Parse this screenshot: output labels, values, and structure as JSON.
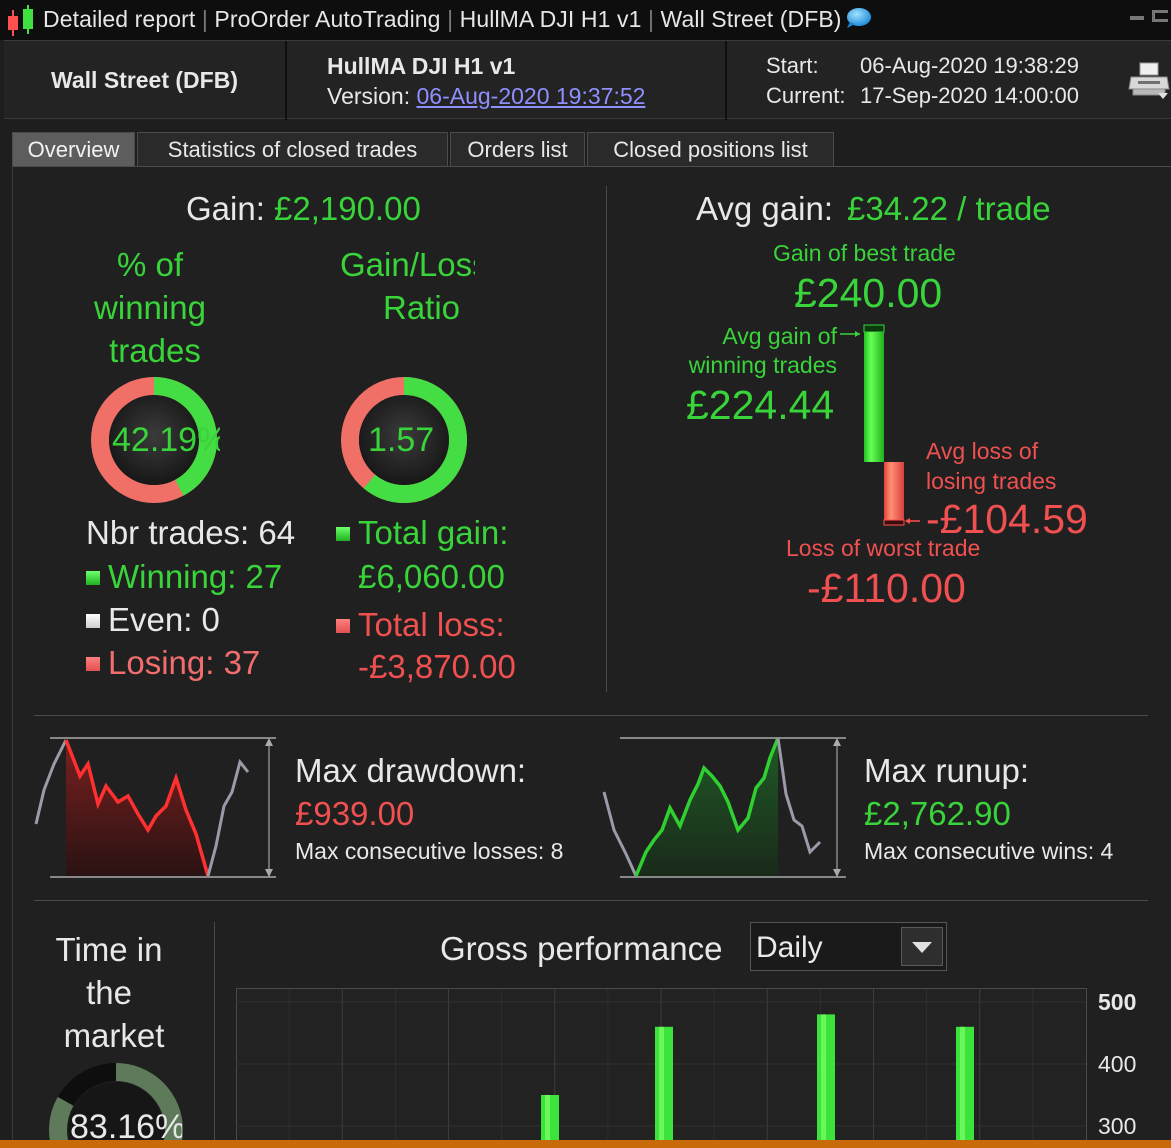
{
  "window": {
    "title_parts": [
      "Detailed report",
      "ProOrder AutoTrading",
      "HullMA DJI H1 v1",
      "Wall Street (DFB)"
    ],
    "app_icon": "candlestick-icon",
    "chat_icon": "speech-bubble-icon"
  },
  "header": {
    "market": "Wall Street (DFB)",
    "strategy": "HullMA DJI H1 v1",
    "version_label": "Version:",
    "version_value": "06-Aug-2020 19:37:52",
    "start_label": "Start:",
    "start_value": "06-Aug-2020 19:38:29",
    "current_label": "Current:",
    "current_value": "17-Sep-2020 14:00:00",
    "print_icon": "printer-icon"
  },
  "tabs": [
    {
      "label": "Overview",
      "active": true
    },
    {
      "label": "Statistics of closed trades",
      "active": false
    },
    {
      "label": "Orders list",
      "active": false
    },
    {
      "label": "Closed positions list",
      "active": false
    }
  ],
  "overview": {
    "gain_label": "Gain:",
    "gain_value": "£2,190.00",
    "pct_winning_label_lines": [
      "% of",
      "winning",
      "trades"
    ],
    "pct_winning_value": "42.19%",
    "pct_winning_fraction": 0.4219,
    "ratio_label_lines": [
      "Gain/Loss",
      "Ratio"
    ],
    "ratio_value": "1.57",
    "ratio_green_fraction": 0.61,
    "nbr_trades": "Nbr trades: 64",
    "winning": "Winning: 27",
    "even": "Even: 0",
    "losing": "Losing: 37",
    "total_gain_label": "Total gain:",
    "total_gain_value": "£6,060.00",
    "total_loss_label": "Total loss:",
    "total_loss_value": "-£3,870.00",
    "avg_gain_label": "Avg gain:",
    "avg_gain_value": "£34.22 / trade",
    "best_trade_label": "Gain of best trade",
    "best_trade_value": "£240.00",
    "avg_win_label_lines": [
      "Avg gain of",
      "winning trades"
    ],
    "avg_win_value": "£224.44",
    "avg_loss_label_lines": [
      "Avg loss of",
      "losing trades"
    ],
    "avg_loss_value": "-£104.59",
    "worst_trade_label": "Loss of worst trade",
    "worst_trade_value": "-£110.00",
    "max_drawdown_label": "Max drawdown:",
    "max_drawdown_value": "£939.00",
    "max_consec_losses": "Max consecutive losses: 8",
    "max_runup_label": "Max runup:",
    "max_runup_value": "£2,762.90",
    "max_consec_wins": "Max consecutive wins: 4",
    "time_in_market_label_lines": [
      "Time in",
      "the",
      "market"
    ],
    "time_in_market_value": "83.16%",
    "time_in_market_fraction": 0.8316,
    "gross_perf_label": "Gross performance",
    "period_selected": "Daily"
  },
  "colors": {
    "gain": "#38d43a",
    "loss": "#ff4d4d",
    "background": "#202020",
    "link": "#8f8fff"
  },
  "chart_data": {
    "type": "bar",
    "title": "Gross performance",
    "y_tick_labels": [
      "500",
      "400",
      "300"
    ],
    "ylim": [
      200,
      500
    ],
    "values": [
      null,
      null,
      null,
      null,
      null,
      350,
      460,
      null,
      null,
      null,
      480,
      null,
      null,
      460,
      null,
      null
    ]
  }
}
